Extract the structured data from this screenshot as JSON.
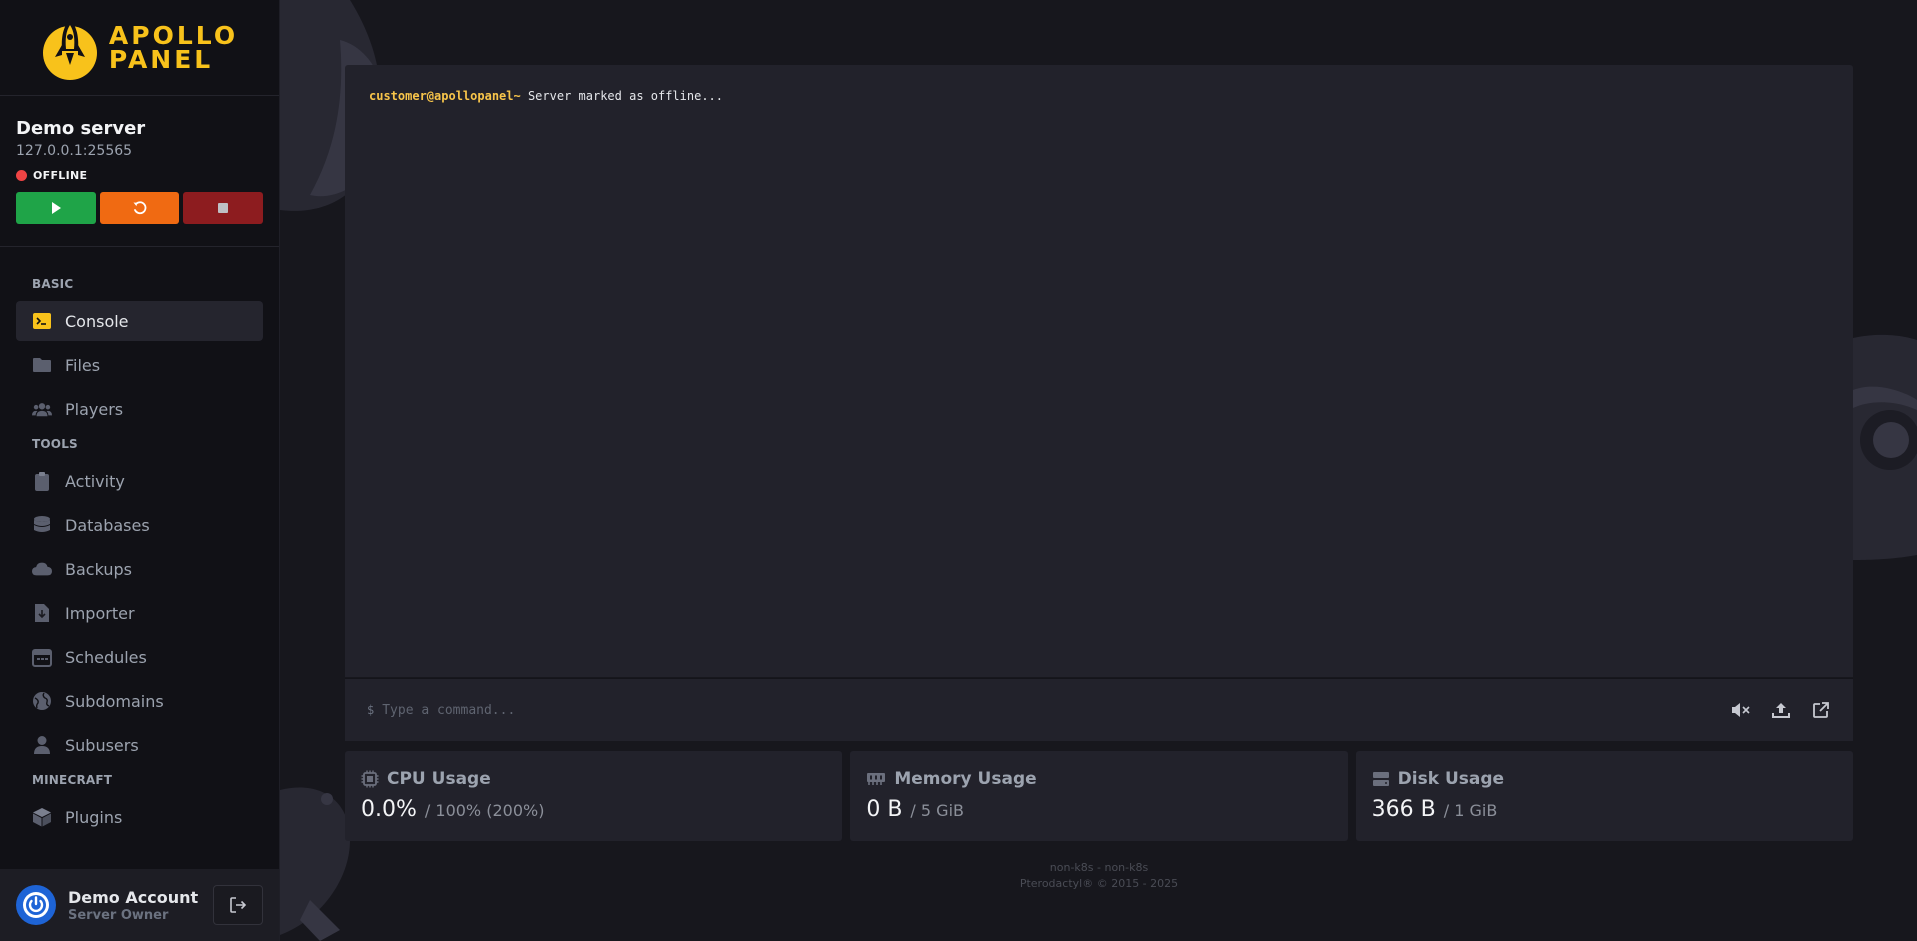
{
  "brand": {
    "line1": "APOLLO",
    "line2": "PANEL",
    "accent": "#f8c21b"
  },
  "server": {
    "name": "Demo server",
    "address": "127.0.0.1:25565",
    "status": "OFFLINE",
    "status_color": "#ef4444",
    "power_buttons": [
      {
        "name": "start",
        "icon": "play-icon",
        "color": "#1fa448"
      },
      {
        "name": "restart",
        "icon": "restart-icon",
        "color": "#f06a12"
      },
      {
        "name": "stop",
        "icon": "stop-icon",
        "color": "#8d1c1f"
      }
    ]
  },
  "nav": {
    "sections": [
      {
        "title": "BASIC",
        "items": [
          {
            "label": "Console",
            "icon": "terminal-icon",
            "active": true
          },
          {
            "label": "Files",
            "icon": "folder-icon"
          },
          {
            "label": "Players",
            "icon": "users-icon"
          }
        ]
      },
      {
        "title": "TOOLS",
        "items": [
          {
            "label": "Activity",
            "icon": "clipboard-icon"
          },
          {
            "label": "Databases",
            "icon": "database-icon"
          },
          {
            "label": "Backups",
            "icon": "cloud-icon"
          },
          {
            "label": "Importer",
            "icon": "file-import-icon"
          },
          {
            "label": "Schedules",
            "icon": "calendar-icon"
          },
          {
            "label": "Subdomains",
            "icon": "globe-icon"
          },
          {
            "label": "Subusers",
            "icon": "user-icon"
          }
        ]
      },
      {
        "title": "MINECRAFT",
        "items": [
          {
            "label": "Plugins",
            "icon": "cube-icon"
          }
        ]
      }
    ]
  },
  "account": {
    "name": "Demo Account",
    "role": "Server Owner"
  },
  "console": {
    "prompt_user": "customer@apollopanel~",
    "message": " Server marked as offline...",
    "input_prefix": "$",
    "input_placeholder": "Type a command..."
  },
  "stats": {
    "cpu": {
      "title": "CPU Usage",
      "value": "0.0%",
      "limit": "/ 100% (200%)"
    },
    "memory": {
      "title": "Memory Usage",
      "value": "0 B",
      "limit": "/ 5 GiB"
    },
    "disk": {
      "title": "Disk Usage",
      "value": "366 B",
      "limit": "/ 1 GiB"
    }
  },
  "footer": {
    "line1": "non-k8s - non-k8s",
    "line2": "Pterodactyl® © 2015 - 2025"
  }
}
